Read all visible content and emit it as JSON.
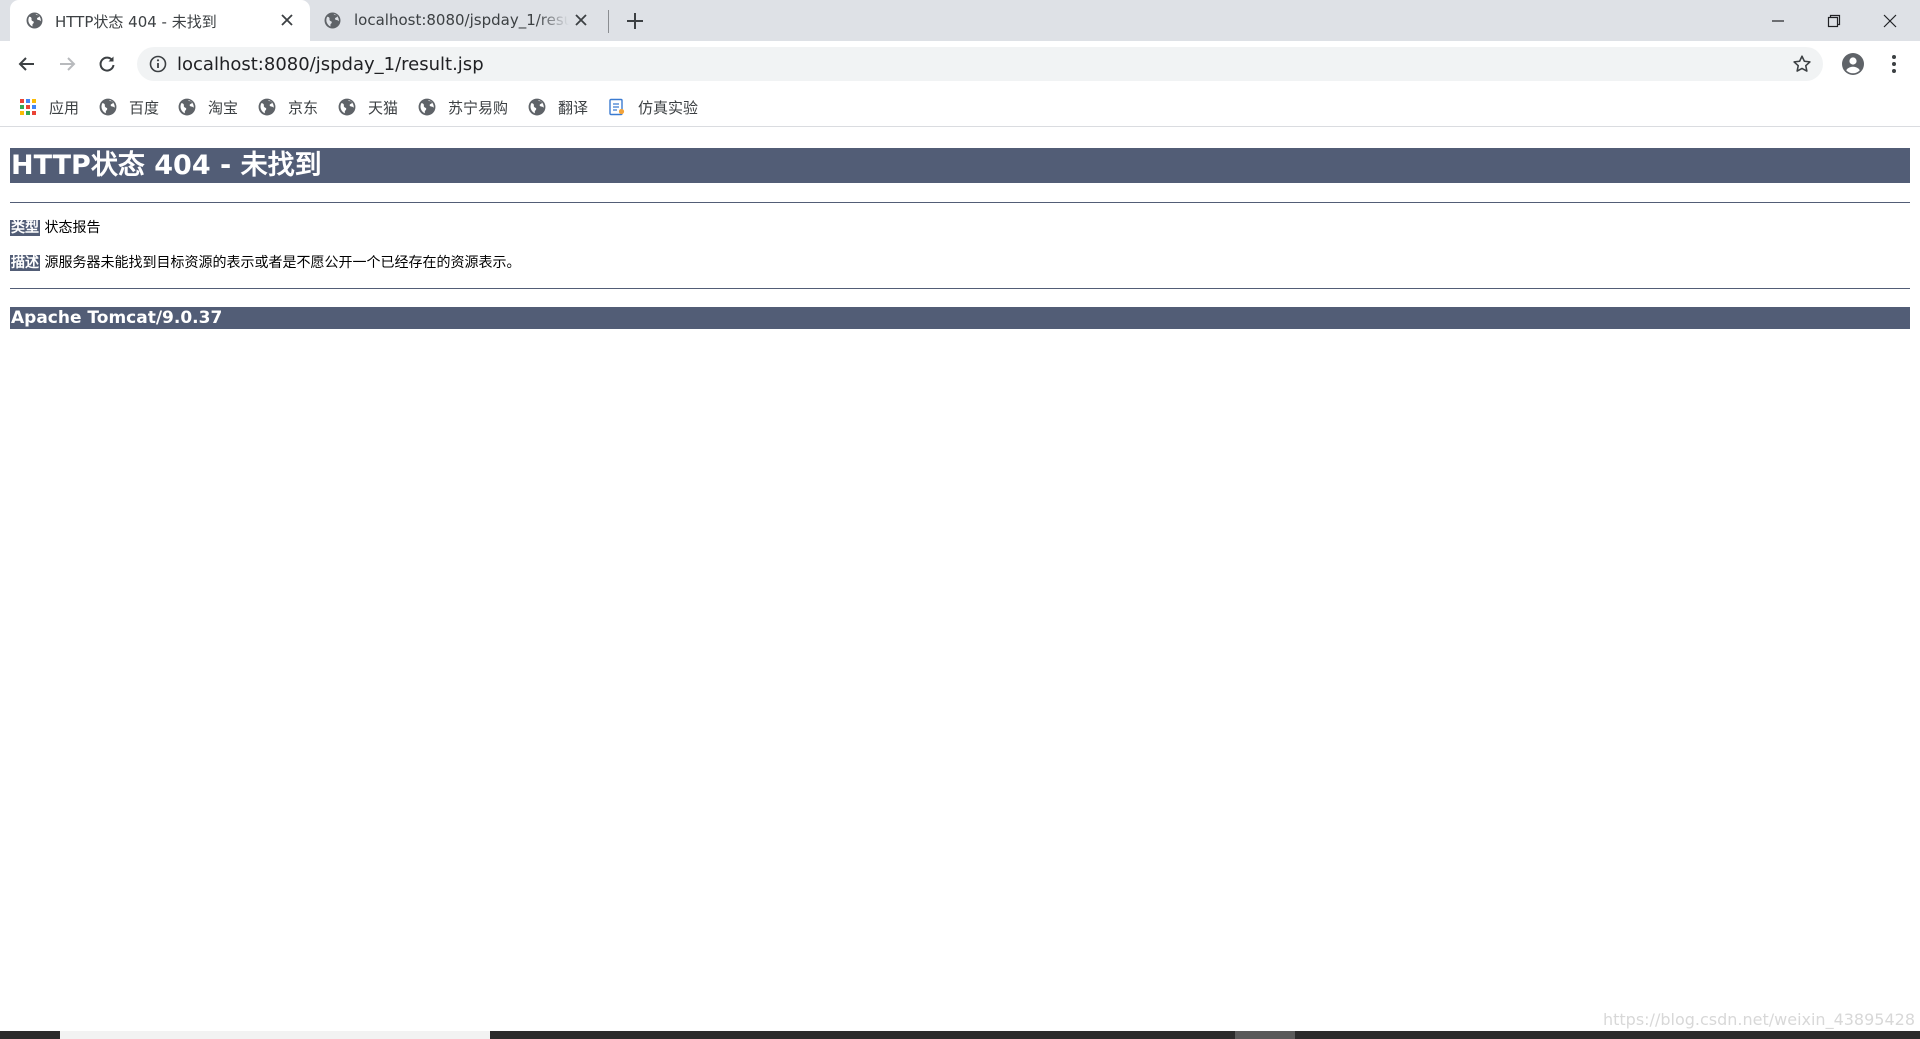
{
  "browser": {
    "tabs": [
      {
        "title": "HTTP状态 404 - 未找到",
        "active": true
      },
      {
        "title": "localhost:8080/jspday_1/result.jsp",
        "active": false
      }
    ],
    "address_bar": {
      "url": "localhost:8080/jspday_1/result.jsp"
    },
    "bookmarks": [
      {
        "label": "应用",
        "icon": "apps-grid-icon"
      },
      {
        "label": "百度",
        "icon": "globe-icon"
      },
      {
        "label": "淘宝",
        "icon": "globe-icon"
      },
      {
        "label": "京东",
        "icon": "globe-icon"
      },
      {
        "label": "天猫",
        "icon": "globe-icon"
      },
      {
        "label": "苏宁易购",
        "icon": "globe-icon"
      },
      {
        "label": "翻译",
        "icon": "globe-icon"
      },
      {
        "label": "仿真实验",
        "icon": "document-icon"
      }
    ]
  },
  "error_page": {
    "heading": "HTTP状态 404 - 未找到",
    "type_label": "类型",
    "type_value": "状态报告",
    "description_label": "描述",
    "description_value": "源服务器未能找到目标资源的表示或者是不愿公开一个已经存在的资源表示。",
    "server": "Apache Tomcat/9.0.37",
    "colors": {
      "banner": "#525d76",
      "banner_text": "#ffffff"
    }
  },
  "watermark": "https://blog.csdn.net/weixin_43895428"
}
